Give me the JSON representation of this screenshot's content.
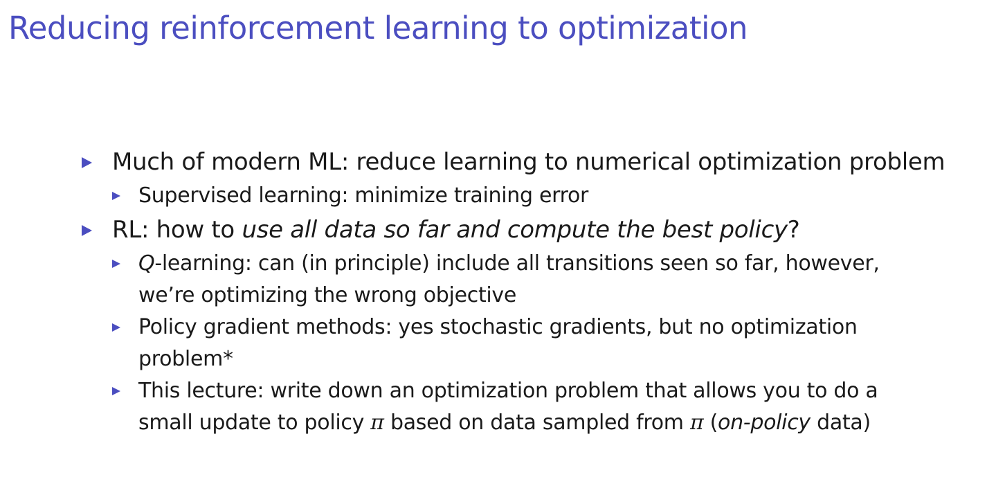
{
  "slide": {
    "title": "Reducing reinforcement learning to optimization"
  },
  "bullets": [
    {
      "text": "Much of modern ML: reduce learning to numerical optimization problem",
      "sub": [
        {
          "text": "Supervised learning: minimize training error"
        }
      ]
    },
    {
      "text_prefix": "RL: how to ",
      "text_emph": "use all data so far and compute the best policy",
      "text_suffix": "?",
      "sub": [
        {
          "q": "Q",
          "line1_rest": "-learning: can (in principle) include all transitions seen so far, however,",
          "line2": "we’re optimizing the wrong objective"
        },
        {
          "line1": "Policy gradient methods: yes stochastic gradients, but no optimization",
          "line2": "problem*"
        },
        {
          "line1": "This lecture: write down an optimization problem that allows you to do a",
          "line2_a": "small update to policy ",
          "pi": "π",
          "line2_b": " based on data sampled from ",
          "line2_c": " (",
          "line2_emph": "on-policy",
          "line2_d": " data)"
        }
      ]
    }
  ]
}
